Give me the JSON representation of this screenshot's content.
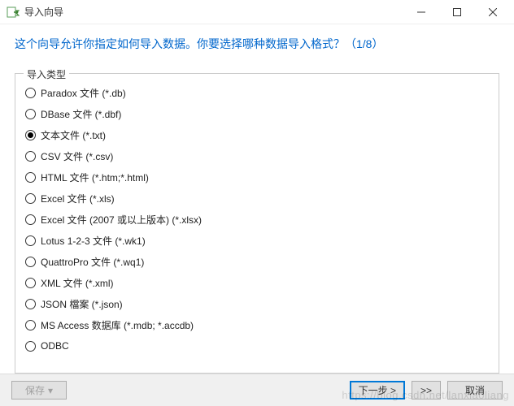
{
  "window": {
    "title": "导入向导"
  },
  "heading": "这个向导允许你指定如何导入数据。你要选择哪种数据导入格式？（1/8）",
  "group": {
    "legend": "导入类型",
    "options": [
      {
        "label": "Paradox 文件 (*.db)",
        "selected": false
      },
      {
        "label": "DBase 文件 (*.dbf)",
        "selected": false
      },
      {
        "label": "文本文件 (*.txt)",
        "selected": true
      },
      {
        "label": "CSV 文件 (*.csv)",
        "selected": false
      },
      {
        "label": "HTML 文件 (*.htm;*.html)",
        "selected": false
      },
      {
        "label": "Excel 文件 (*.xls)",
        "selected": false
      },
      {
        "label": "Excel 文件 (2007 或以上版本) (*.xlsx)",
        "selected": false
      },
      {
        "label": "Lotus 1-2-3 文件 (*.wk1)",
        "selected": false
      },
      {
        "label": "QuattroPro 文件 (*.wq1)",
        "selected": false
      },
      {
        "label": "XML 文件 (*.xml)",
        "selected": false
      },
      {
        "label": "JSON 檔案 (*.json)",
        "selected": false
      },
      {
        "label": "MS Access 数据库 (*.mdb; *.accdb)",
        "selected": false
      },
      {
        "label": "ODBC",
        "selected": false
      }
    ]
  },
  "footer": {
    "save": "保存",
    "next": "下一步 >",
    "skip": ">>",
    "cancel": "取消"
  },
  "watermark": "https://blog.csdn.net/lanxiaoliang"
}
